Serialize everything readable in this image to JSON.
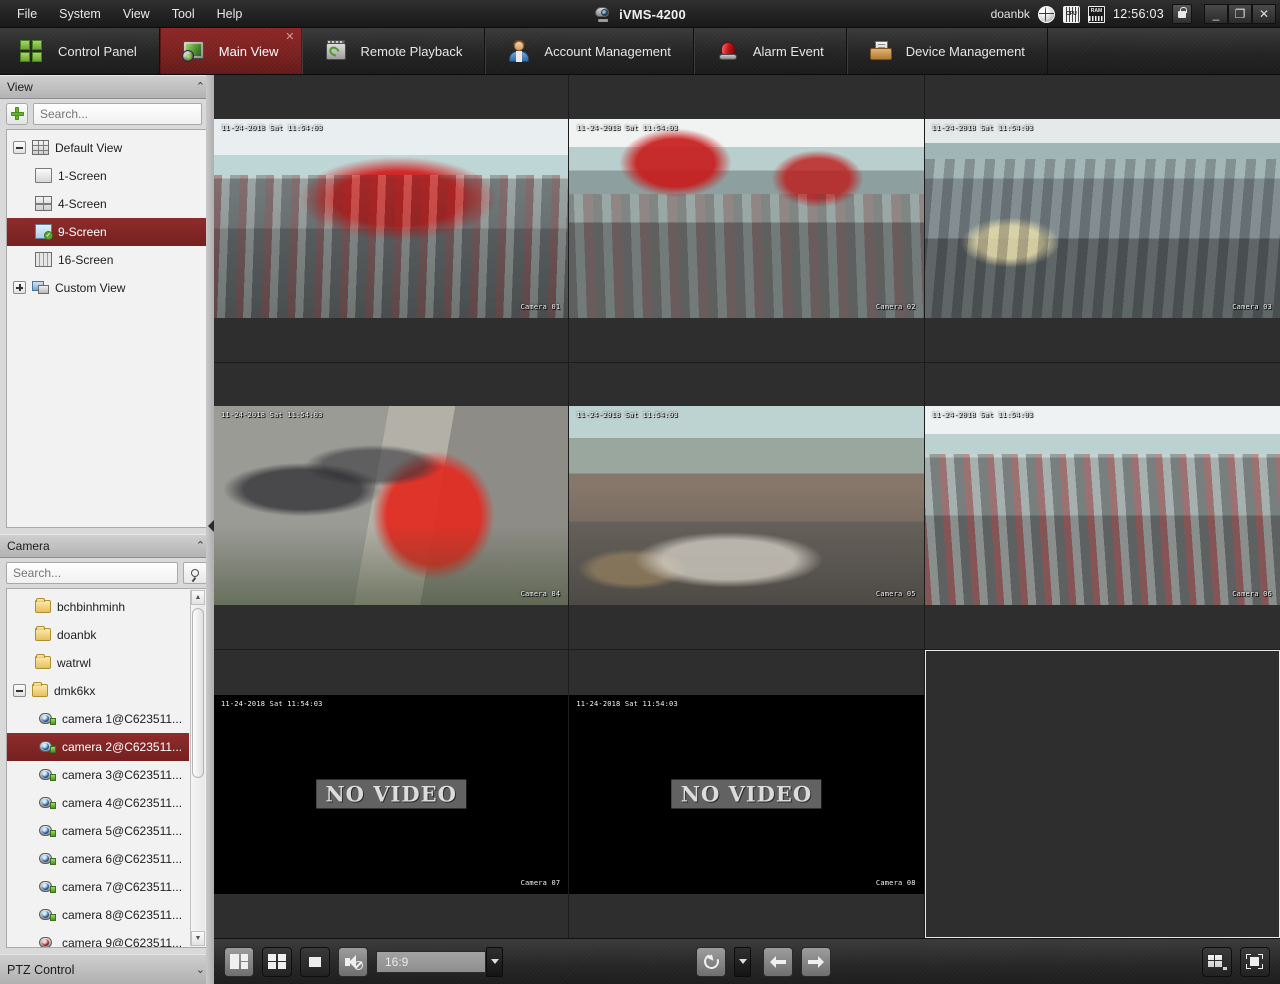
{
  "window": {
    "app_title": "iVMS-4200",
    "user": "doanbk",
    "clock": "12:56:03",
    "minimize": "_",
    "restore": "❐",
    "close": "✕",
    "icons": {
      "app_logo": "camera-logo-icon",
      "globe": "globe-icon",
      "cpu": "CPU",
      "ram": "RAM",
      "lock": "lock-icon"
    }
  },
  "menubar": {
    "items": [
      {
        "label": "File"
      },
      {
        "label": "System"
      },
      {
        "label": "View"
      },
      {
        "label": "Tool"
      },
      {
        "label": "Help"
      }
    ]
  },
  "tabs": [
    {
      "label": "Control Panel",
      "icon": "control-panel-icon",
      "active": false
    },
    {
      "label": "Main View",
      "icon": "main-view-icon",
      "active": true,
      "close": "✕"
    },
    {
      "label": "Remote Playback",
      "icon": "remote-playback-icon",
      "active": false
    },
    {
      "label": "Account Management",
      "icon": "account-management-icon",
      "active": false
    },
    {
      "label": "Alarm Event",
      "icon": "alarm-event-icon",
      "active": false
    },
    {
      "label": "Device Management",
      "icon": "device-management-icon",
      "active": false
    }
  ],
  "view_panel": {
    "title": "View",
    "collapse": "⌃",
    "search_placeholder": "Search...",
    "add_tooltip": "+",
    "tree": [
      {
        "label": "Default View",
        "icon": "grid-view-icon",
        "toggle": "minus",
        "level": 0,
        "selected": false
      },
      {
        "label": "1-Screen",
        "icon": "one-screen-icon",
        "level": 1,
        "selected": false
      },
      {
        "label": "4-Screen",
        "icon": "four-screen-icon",
        "level": 1,
        "selected": false
      },
      {
        "label": "9-Screen",
        "icon": "nine-screen-icon",
        "level": 1,
        "selected": true
      },
      {
        "label": "16-Screen",
        "icon": "sixteen-screen-icon",
        "level": 1,
        "selected": false
      },
      {
        "label": "Custom View",
        "icon": "custom-view-icon",
        "toggle": "plus",
        "level": 0,
        "selected": false
      }
    ]
  },
  "camera_panel": {
    "title": "Camera",
    "collapse": "⌃",
    "search_placeholder": "Search...",
    "items": [
      {
        "label": "bchbinhminh",
        "type": "folder",
        "level": 1,
        "selected": false
      },
      {
        "label": "doanbk",
        "type": "folder",
        "level": 1,
        "selected": false
      },
      {
        "label": "watrwl",
        "type": "folder",
        "level": 1,
        "selected": false
      },
      {
        "label": "dmk6kx",
        "type": "folder",
        "level": 0,
        "toggle": "minus",
        "selected": false
      },
      {
        "label": "camera 1@C623511...",
        "type": "camera",
        "level": 2,
        "selected": false,
        "online": true
      },
      {
        "label": "camera 2@C623511...",
        "type": "camera",
        "level": 2,
        "selected": true,
        "online": true
      },
      {
        "label": "camera 3@C623511...",
        "type": "camera",
        "level": 2,
        "selected": false,
        "online": true
      },
      {
        "label": "camera 4@C623511...",
        "type": "camera",
        "level": 2,
        "selected": false,
        "online": true
      },
      {
        "label": "camera 5@C623511...",
        "type": "camera",
        "level": 2,
        "selected": false,
        "online": true
      },
      {
        "label": "camera 6@C623511...",
        "type": "camera",
        "level": 2,
        "selected": false,
        "online": true
      },
      {
        "label": "camera 7@C623511...",
        "type": "camera",
        "level": 2,
        "selected": false,
        "online": true
      },
      {
        "label": "camera 8@C623511...",
        "type": "camera",
        "level": 2,
        "selected": false,
        "online": true
      },
      {
        "label": "camera 9@C623511...",
        "type": "camera",
        "level": 2,
        "selected": false,
        "online": false
      }
    ]
  },
  "ptz_panel": {
    "title": "PTZ Control",
    "expand": "⌄"
  },
  "video_grid": {
    "layout": "9-Screen",
    "cells": [
      {
        "index": 1,
        "state": "live",
        "scene": "sc-store1",
        "osd_time": "11-24-2018 Sat 11:54:03",
        "osd_name": "Camera 01",
        "selected": false
      },
      {
        "index": 2,
        "state": "live",
        "scene": "sc-store2",
        "osd_time": "11-24-2018 Sat 11:54:03",
        "osd_name": "Camera 02",
        "selected": false
      },
      {
        "index": 3,
        "state": "live",
        "scene": "sc-store3",
        "osd_time": "11-24-2018 Sat 11:54:03",
        "osd_name": "Camera 03",
        "selected": false
      },
      {
        "index": 4,
        "state": "live",
        "scene": "sc-street",
        "osd_time": "11-24-2018 Sat 11:54:03",
        "osd_name": "Camera 04",
        "selected": false
      },
      {
        "index": 5,
        "state": "live",
        "scene": "sc-room",
        "osd_time": "11-24-2018 Sat 11:54:03",
        "osd_name": "Camera 05",
        "selected": false
      },
      {
        "index": 6,
        "state": "live",
        "scene": "sc-store4",
        "osd_time": "11-24-2018 Sat 11:54:03",
        "osd_name": "Camera 06",
        "selected": false
      },
      {
        "index": 7,
        "state": "no-video",
        "message": "NO VIDEO",
        "osd_time": "11-24-2018 Sat 11:54:03",
        "osd_name": "Camera 07",
        "selected": false
      },
      {
        "index": 8,
        "state": "no-video",
        "message": "NO VIDEO",
        "osd_time": "11-24-2018 Sat 11:54:03",
        "osd_name": "Camera 08",
        "selected": false
      },
      {
        "index": 9,
        "state": "empty",
        "selected": true
      }
    ]
  },
  "bottom_toolbar": {
    "save_view_icon": "save-view-icon",
    "layout_icon": "layout-icon",
    "stop_all_icon": "stop-all-icon",
    "mute_icon": "mute-icon",
    "aspect_ratio": "16:9",
    "aspect_dropdown_icon": "chevron-down-icon",
    "loop_icon": "auto-switch-icon",
    "loop_dropdown_icon": "chevron-down-icon",
    "previous_icon": "previous-arrow-icon",
    "next_icon": "next-arrow-icon",
    "window_division_icon": "window-division-icon",
    "fullscreen_icon": "fullscreen-icon"
  },
  "colors": {
    "accent_red": "#8d2626",
    "selection_red": "#8e2c2b",
    "panel_gray": "#d9d9d9",
    "stage_gray": "#2e2e2e",
    "chrome_dark": "#242424"
  }
}
